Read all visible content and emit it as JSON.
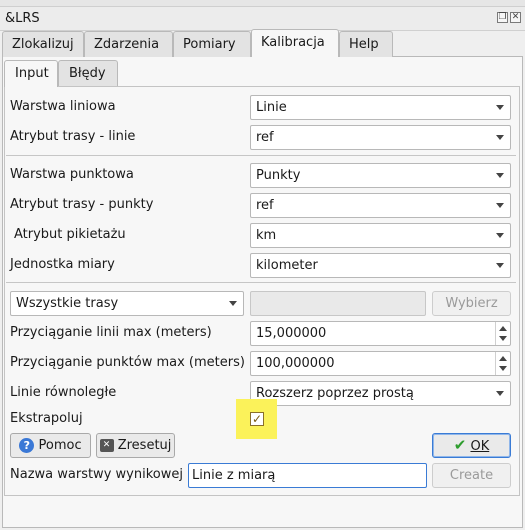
{
  "window": {
    "title": "&LRS"
  },
  "main_tabs": [
    "Zlokalizuj",
    "Zdarzenia",
    "Pomiary",
    "Kalibracja",
    "Help"
  ],
  "sub_tabs": [
    "Input",
    "Błędy"
  ],
  "form": {
    "warstwa_liniowa": {
      "label": "Warstwa liniowa",
      "value": "Linie"
    },
    "atrybut_trasy_linie": {
      "label": "Atrybut trasy - linie",
      "value": "ref"
    },
    "warstwa_punktowa": {
      "label": "Warstwa punktowa",
      "value": "Punkty"
    },
    "atrybut_trasy_punkty": {
      "label": "Atrybut trasy - punkty",
      "value": "ref"
    },
    "atrybut_pikietazu": {
      "label": "Atrybut pikietażu",
      "value": "km"
    },
    "jednostka_miary": {
      "label": "Jednostka miary",
      "value": "kilometer"
    },
    "trasy_filter": {
      "value": "Wszystkie trasy",
      "button": "Wybierz"
    },
    "przyciaganie_linii": {
      "label": "Przyciąganie linii max (meters)",
      "value": "15,000000"
    },
    "przyciaganie_punktow": {
      "label": "Przyciąganie punktów max (meters)",
      "value": "100,000000"
    },
    "linie_rownolegle": {
      "label": "Linie równoległe",
      "value": "Rozszerz poprzez prostą"
    },
    "ekstrapoluj": {
      "label": "Ekstrapoluj",
      "checked": true,
      "check_glyph": "✓"
    }
  },
  "buttons": {
    "pomoc": "Pomoc",
    "zresetuj": "Zresetuj",
    "ok": "OK",
    "create": "Create"
  },
  "output": {
    "label": "Nazwa warstwy wynikowej",
    "value": "Linie z miarą"
  },
  "colors": {
    "highlight": "#fbf25a",
    "focus": "#3a7bd5",
    "ok_check": "#2e9d2e"
  }
}
